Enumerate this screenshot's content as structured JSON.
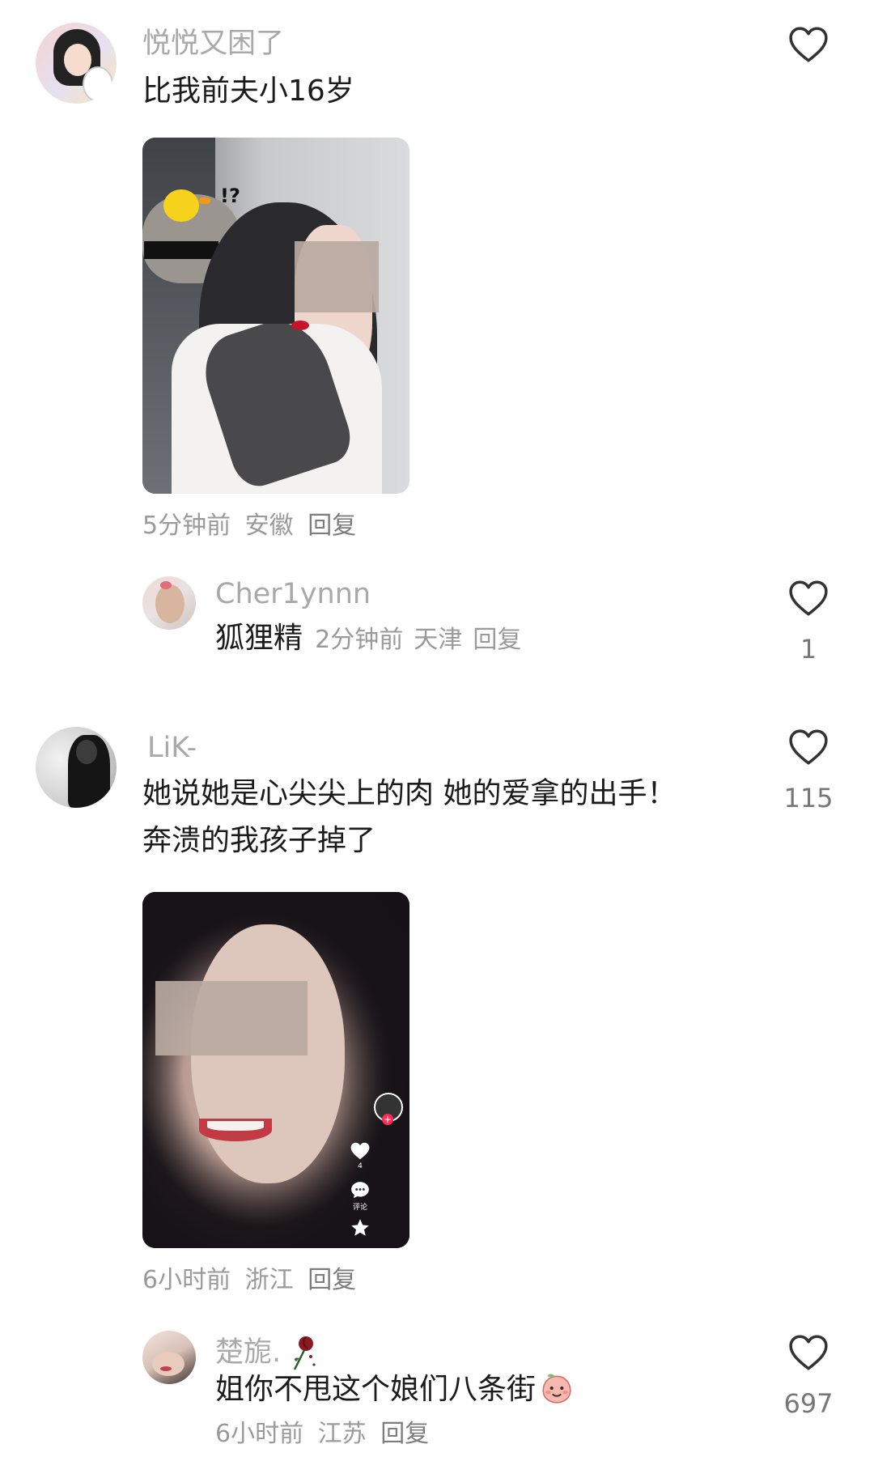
{
  "comments": [
    {
      "username": "悦悦又困了",
      "text": "比我前夫小16岁",
      "time": "5分钟前",
      "location": "安徽",
      "reply_label": "回复",
      "has_photo": true
    },
    {
      "username": "LiK-",
      "text_line1": "她说她是心尖尖上的肉 她的爱拿的出手！",
      "text_line2": "奔溃的我孩子掉了",
      "time": "6小时前",
      "location": "浙江",
      "reply_label": "回复",
      "like_count": "115",
      "has_photo": true,
      "photo_overlay": {
        "like_count": "4",
        "comment_label": "评论"
      }
    }
  ],
  "replies": [
    {
      "username": "Cher1ynnn",
      "text": "狐狸精",
      "time": "2分钟前",
      "location": "天津",
      "reply_label": "回复",
      "like_count": "1"
    },
    {
      "username": "楚旎.",
      "text": "姐你不甩这个娘们八条街",
      "time": "6小时前",
      "location": "江苏",
      "reply_label": "回复",
      "like_count": "697"
    }
  ],
  "colors": {
    "text": "#1b1b1b",
    "username": "#a9a9a9",
    "meta": "#9a9a9a",
    "heart_stroke": "#333333"
  }
}
